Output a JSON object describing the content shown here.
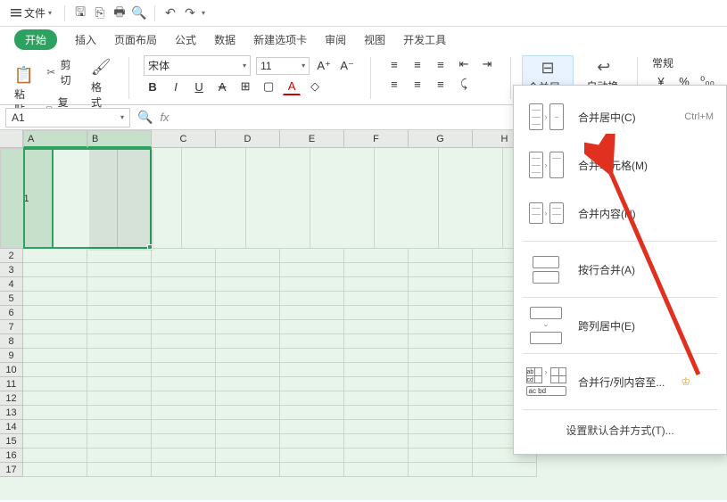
{
  "titlebar": {
    "file_label": "文件"
  },
  "tabs": {
    "active": "开始",
    "items": [
      "插入",
      "页面布局",
      "公式",
      "数据",
      "新建选项卡",
      "审阅",
      "视图",
      "开发工具"
    ]
  },
  "ribbon": {
    "paste": "粘贴",
    "cut": "剪切",
    "copy": "复制",
    "format_painter": "格式刷",
    "font_name": "宋体",
    "font_size": "11",
    "merge_center": "合并居中",
    "wrap_text": "自动换行",
    "number_format": "常规",
    "currency": "¥",
    "percent": "%",
    "thousands": "⁰₀₀"
  },
  "namebox": {
    "cell": "A1"
  },
  "columns": [
    "A",
    "B",
    "C",
    "D",
    "E",
    "F",
    "G",
    "H"
  ],
  "rows": [
    1,
    2,
    3,
    4,
    5,
    6,
    7,
    8,
    9,
    10,
    11,
    12,
    13,
    14,
    15,
    16,
    17
  ],
  "col_widths": {
    "A": 72,
    "B": 72,
    "default": 72
  },
  "row_heights": {
    "1": 113,
    "default": 16
  },
  "selection": {
    "range": "A1:B1",
    "active": "A1"
  },
  "dropdown": {
    "items": [
      {
        "label": "合并居中(C)",
        "shortcut": "Ctrl+M"
      },
      {
        "label": "合并单元格(M)"
      },
      {
        "label": "合并内容(N)"
      },
      {
        "label": "按行合并(A)"
      },
      {
        "label": "跨列居中(E)"
      },
      {
        "label": "合并行/列内容至...",
        "crown": true
      }
    ],
    "setting": "设置默认合并方式(T)..."
  }
}
